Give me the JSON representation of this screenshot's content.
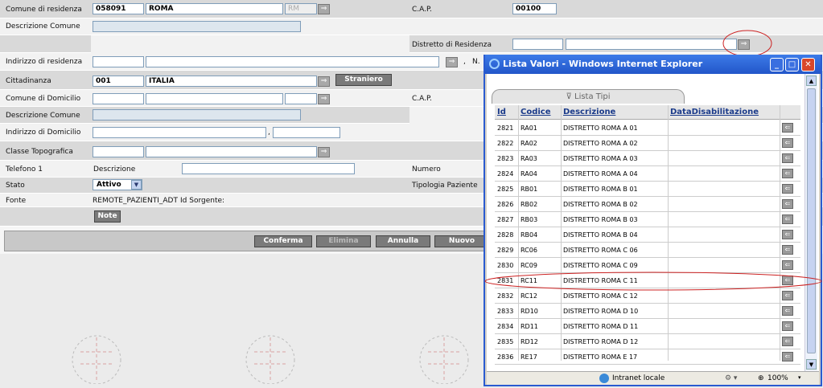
{
  "form": {
    "comune_residenza_label": "Comune di residenza",
    "comune_code": "058091",
    "comune_name": "ROMA",
    "prov": "RM",
    "cap_label": "C.A.P.",
    "cap_value": "00100",
    "descr_comune_label": "Descrizione Comune",
    "distretto_label": "Distretto di Residenza",
    "indirizzo_res_label": "Indirizzo di residenza",
    "comma": ",",
    "n_label": "N.",
    "cittadinanza_label": "Cittadinanza",
    "citt_code": "001",
    "citt_name": "ITALIA",
    "straniero_btn": "Straniero",
    "comune_domicilio_label": "Comune di Domicilio",
    "cap2_label": "C.A.P.",
    "descr_comune2_label": "Descrizione Comune",
    "indirizzo_dom_label": "Indirizzo di Domicilio",
    "comma2": ",",
    "classe_topo_label": "Classe Topografica",
    "telefono_label": "Telefono 1",
    "descrizione_label": "Descrizione",
    "numero_label": "Numero",
    "stato_label": "Stato",
    "stato_value": "Attivo",
    "tipologia_label": "Tipologia Paziente",
    "fonte_label": "Fonte",
    "fonte_value": "REMOTE_PAZIENTI_ADT",
    "id_sorgente_label": "Id Sorgente:",
    "note_btn": "Note",
    "arrow_glyph": "⇒",
    "dropdown_glyph": "▼"
  },
  "actions": {
    "conferma": "Conferma",
    "elimina": "Elimina",
    "annulla": "Annulla",
    "nuovo": "Nuovo"
  },
  "popup": {
    "title": "Lista Valori - Windows Internet Explorer",
    "min": "_",
    "max": "□",
    "close": "✕",
    "tab_label": "Lista Tipi",
    "headers": {
      "id": "Id",
      "codice": "Codice",
      "descrizione": "Descrizione",
      "data": "DataDisabilitazione"
    },
    "row_btn": "⇐",
    "rows": [
      {
        "id": "2821",
        "codice": "RA01",
        "descrizione": "DISTRETTO ROMA A 01"
      },
      {
        "id": "2822",
        "codice": "RA02",
        "descrizione": "DISTRETTO ROMA A 02"
      },
      {
        "id": "2823",
        "codice": "RA03",
        "descrizione": "DISTRETTO ROMA A 03"
      },
      {
        "id": "2824",
        "codice": "RA04",
        "descrizione": "DISTRETTO ROMA A 04"
      },
      {
        "id": "2825",
        "codice": "RB01",
        "descrizione": "DISTRETTO ROMA B 01"
      },
      {
        "id": "2826",
        "codice": "RB02",
        "descrizione": "DISTRETTO ROMA B 02"
      },
      {
        "id": "2827",
        "codice": "RB03",
        "descrizione": "DISTRETTO ROMA B 03"
      },
      {
        "id": "2828",
        "codice": "RB04",
        "descrizione": "DISTRETTO ROMA B 04"
      },
      {
        "id": "2829",
        "codice": "RC06",
        "descrizione": "DISTRETTO ROMA C 06"
      },
      {
        "id": "2830",
        "codice": "RC09",
        "descrizione": "DISTRETTO ROMA C 09"
      },
      {
        "id": "2831",
        "codice": "RC11",
        "descrizione": "DISTRETTO ROMA C 11"
      },
      {
        "id": "2832",
        "codice": "RC12",
        "descrizione": "DISTRETTO ROMA C 12"
      },
      {
        "id": "2833",
        "codice": "RD10",
        "descrizione": "DISTRETTO ROMA D 10"
      },
      {
        "id": "2834",
        "codice": "RD11",
        "descrizione": "DISTRETTO ROMA D 11"
      },
      {
        "id": "2835",
        "codice": "RD12",
        "descrizione": "DISTRETTO ROMA D 12"
      },
      {
        "id": "2836",
        "codice": "RE17",
        "descrizione": "DISTRETTO ROMA E 17"
      }
    ],
    "status_zone": "Intranet locale",
    "zoom": "100%"
  },
  "colors": {
    "annotation": "#cc2222",
    "titlebar": "#2256c9"
  }
}
